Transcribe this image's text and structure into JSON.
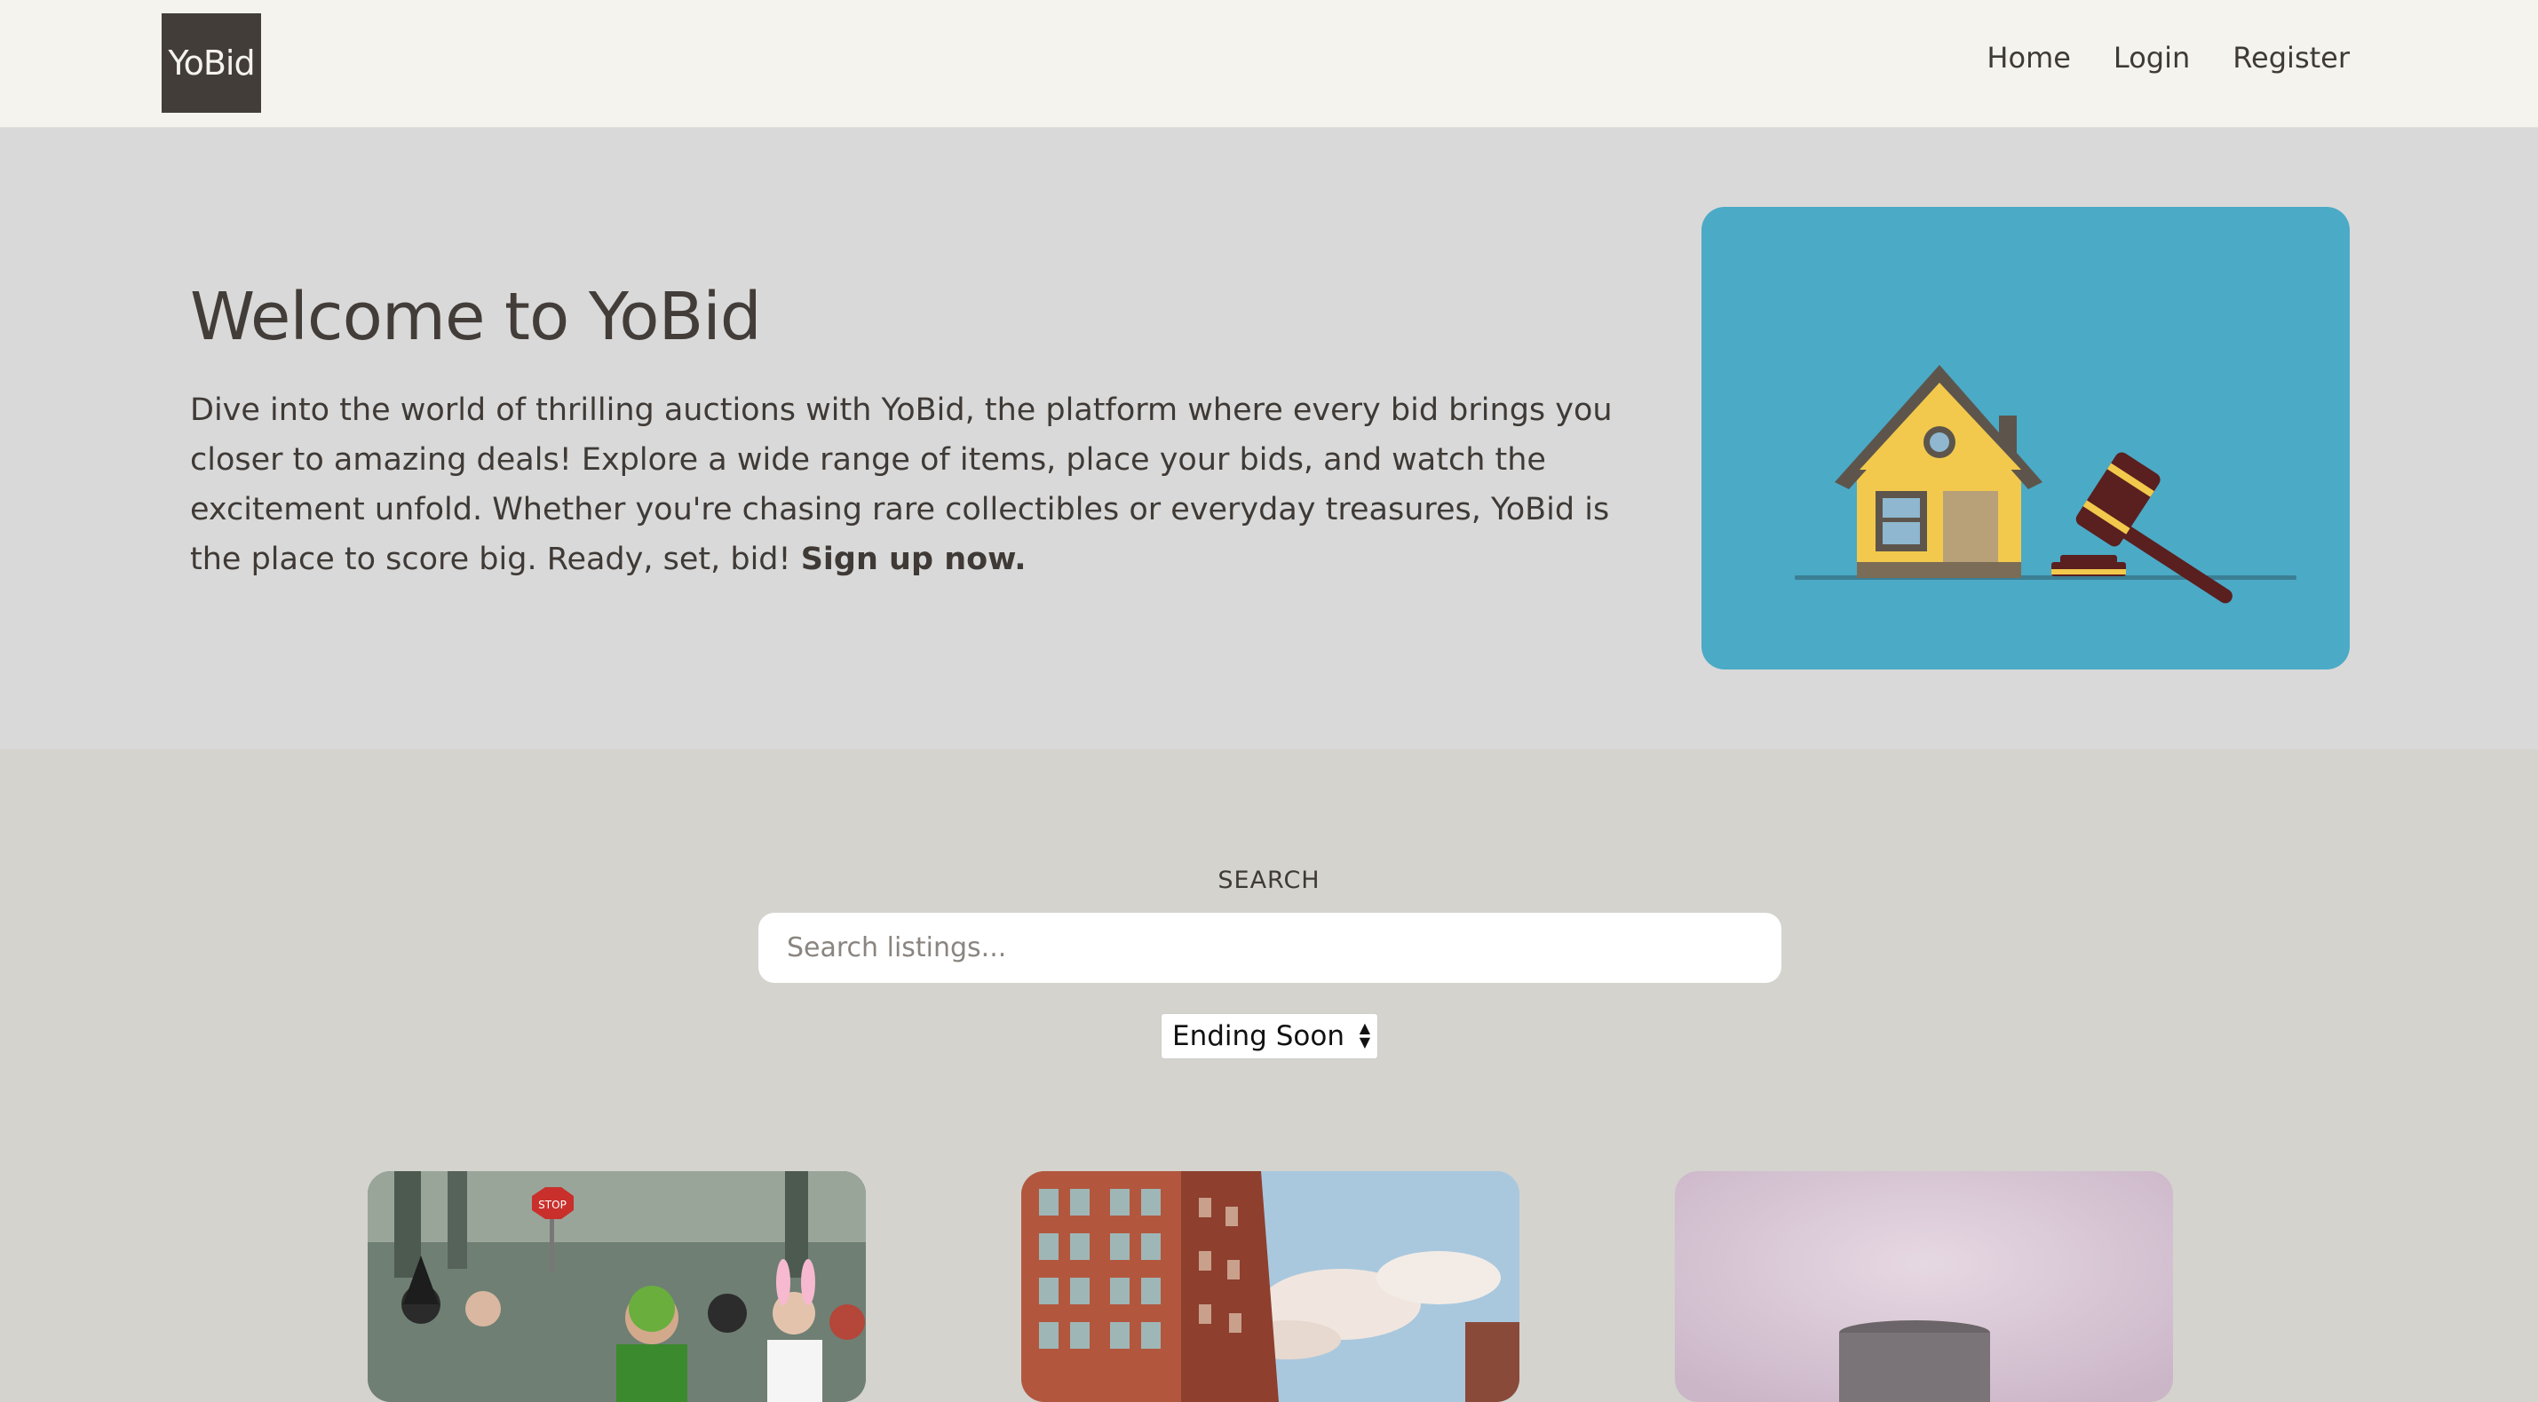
{
  "nav": {
    "brand": "YoBid",
    "links": [
      "Home",
      "Login",
      "Register"
    ]
  },
  "hero": {
    "title": "Welcome to YoBid",
    "text": "Dive into the world of thrilling auctions with YoBid, the platform where every bid brings you closer to amazing deals! Explore a wide range of items, place your bids, and watch the excitement unfold. Whether you're chasing rare collectibles or everyday treasures, YoBid is the place to score big. Ready, set, bid!",
    "cta": "Sign up now.",
    "image_icon": "house-and-gavel-illustration"
  },
  "search": {
    "label": "SEARCH",
    "placeholder": "Search listings...",
    "sort_selected": "Ending Soon"
  },
  "listings": [
    {
      "image_icon": "costume-runners-photo"
    },
    {
      "image_icon": "city-buildings-postcard-photo"
    },
    {
      "image_icon": "product-photo"
    }
  ],
  "colors": {
    "navbar_bg": "#f4f3ee",
    "brand_bg": "#433d39",
    "hero_bg": "#d9d9d9",
    "page_bg": "#d4d3ce",
    "hero_image_bg": "#4baac6",
    "text": "#3f3a36"
  }
}
